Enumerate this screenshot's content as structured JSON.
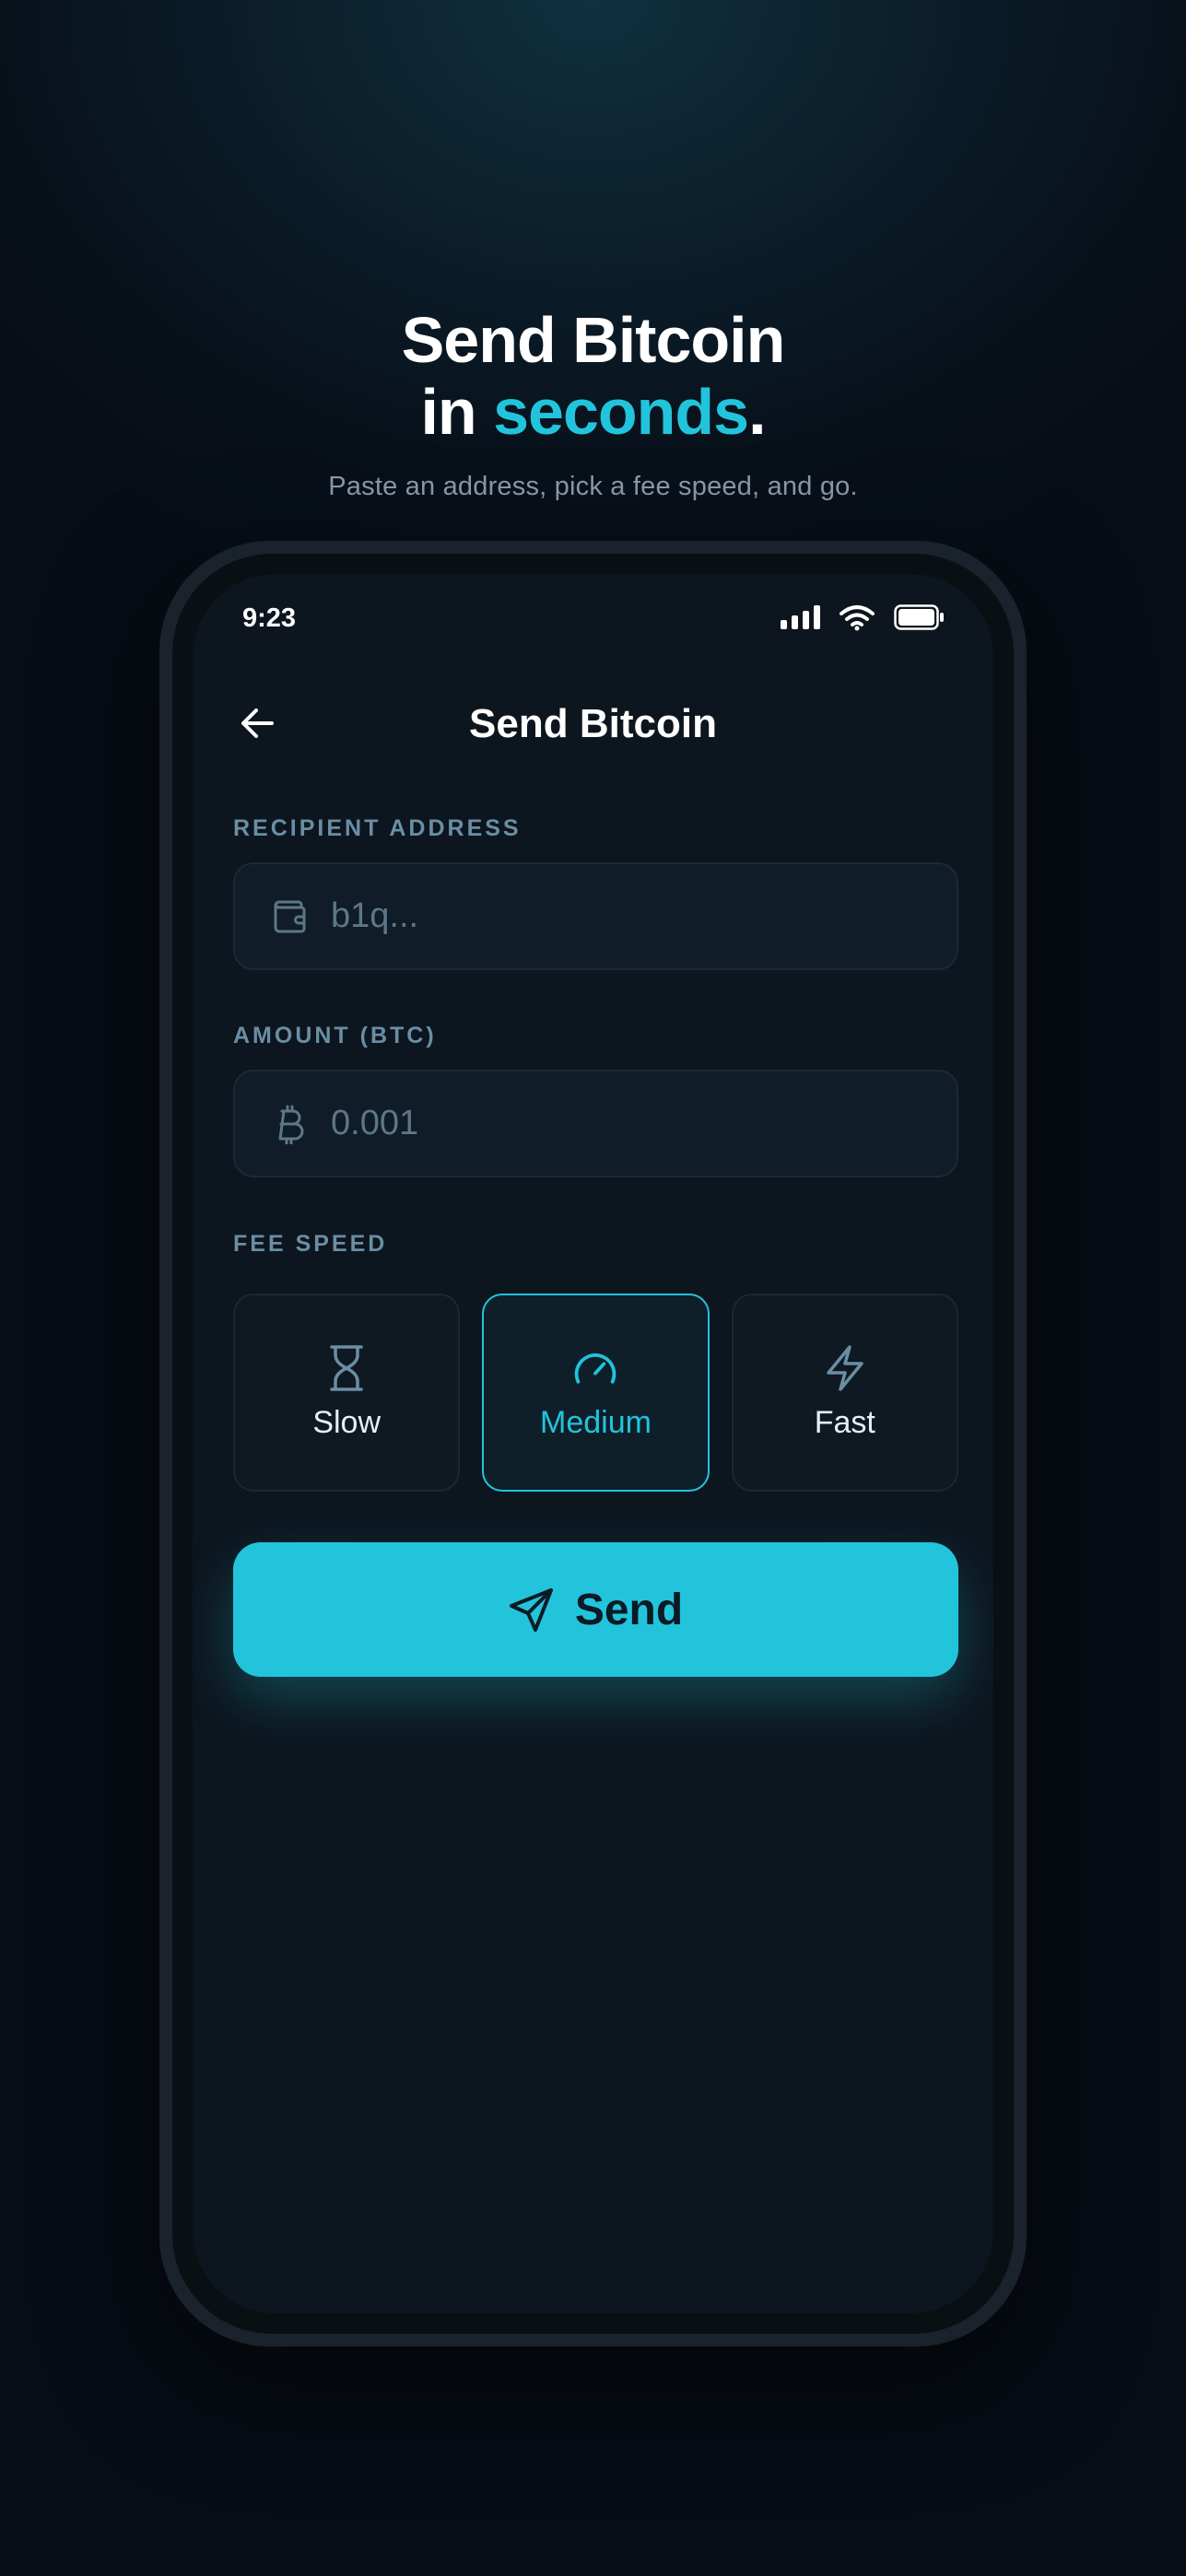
{
  "hero": {
    "title_line1": "Send Bitcoin",
    "title_line2_prefix": "in ",
    "title_line2_accent": "seconds",
    "title_line2_suffix": ".",
    "subtitle": "Paste an address, pick a fee speed, and go."
  },
  "status_bar": {
    "time": "9:23",
    "icons": [
      "signal-icon",
      "wifi-icon",
      "battery-icon"
    ]
  },
  "nav": {
    "back_icon": "arrow-left-icon",
    "title": "Send Bitcoin"
  },
  "form": {
    "recipient": {
      "label": "RECIPIENT ADDRESS",
      "placeholder": "b1q...",
      "value": "",
      "icon": "wallet-icon"
    },
    "amount": {
      "label": "AMOUNT (BTC)",
      "placeholder": "0.001",
      "value": "",
      "icon": "bitcoin-icon"
    },
    "fee_speed": {
      "label": "FEE SPEED",
      "options": [
        {
          "label": "Slow",
          "icon": "hourglass-icon",
          "selected": false
        },
        {
          "label": "Medium",
          "icon": "gauge-icon",
          "selected": true
        },
        {
          "label": "Fast",
          "icon": "lightning-icon",
          "selected": false
        }
      ]
    }
  },
  "send_button": {
    "label": "Send",
    "icon": "paper-plane-icon"
  },
  "colors": {
    "accent": "#22c4dc",
    "background": "#081019",
    "screen": "#0d151e",
    "field": "#101c27",
    "label": "#6a8ea4",
    "muted": "#5d7788"
  }
}
